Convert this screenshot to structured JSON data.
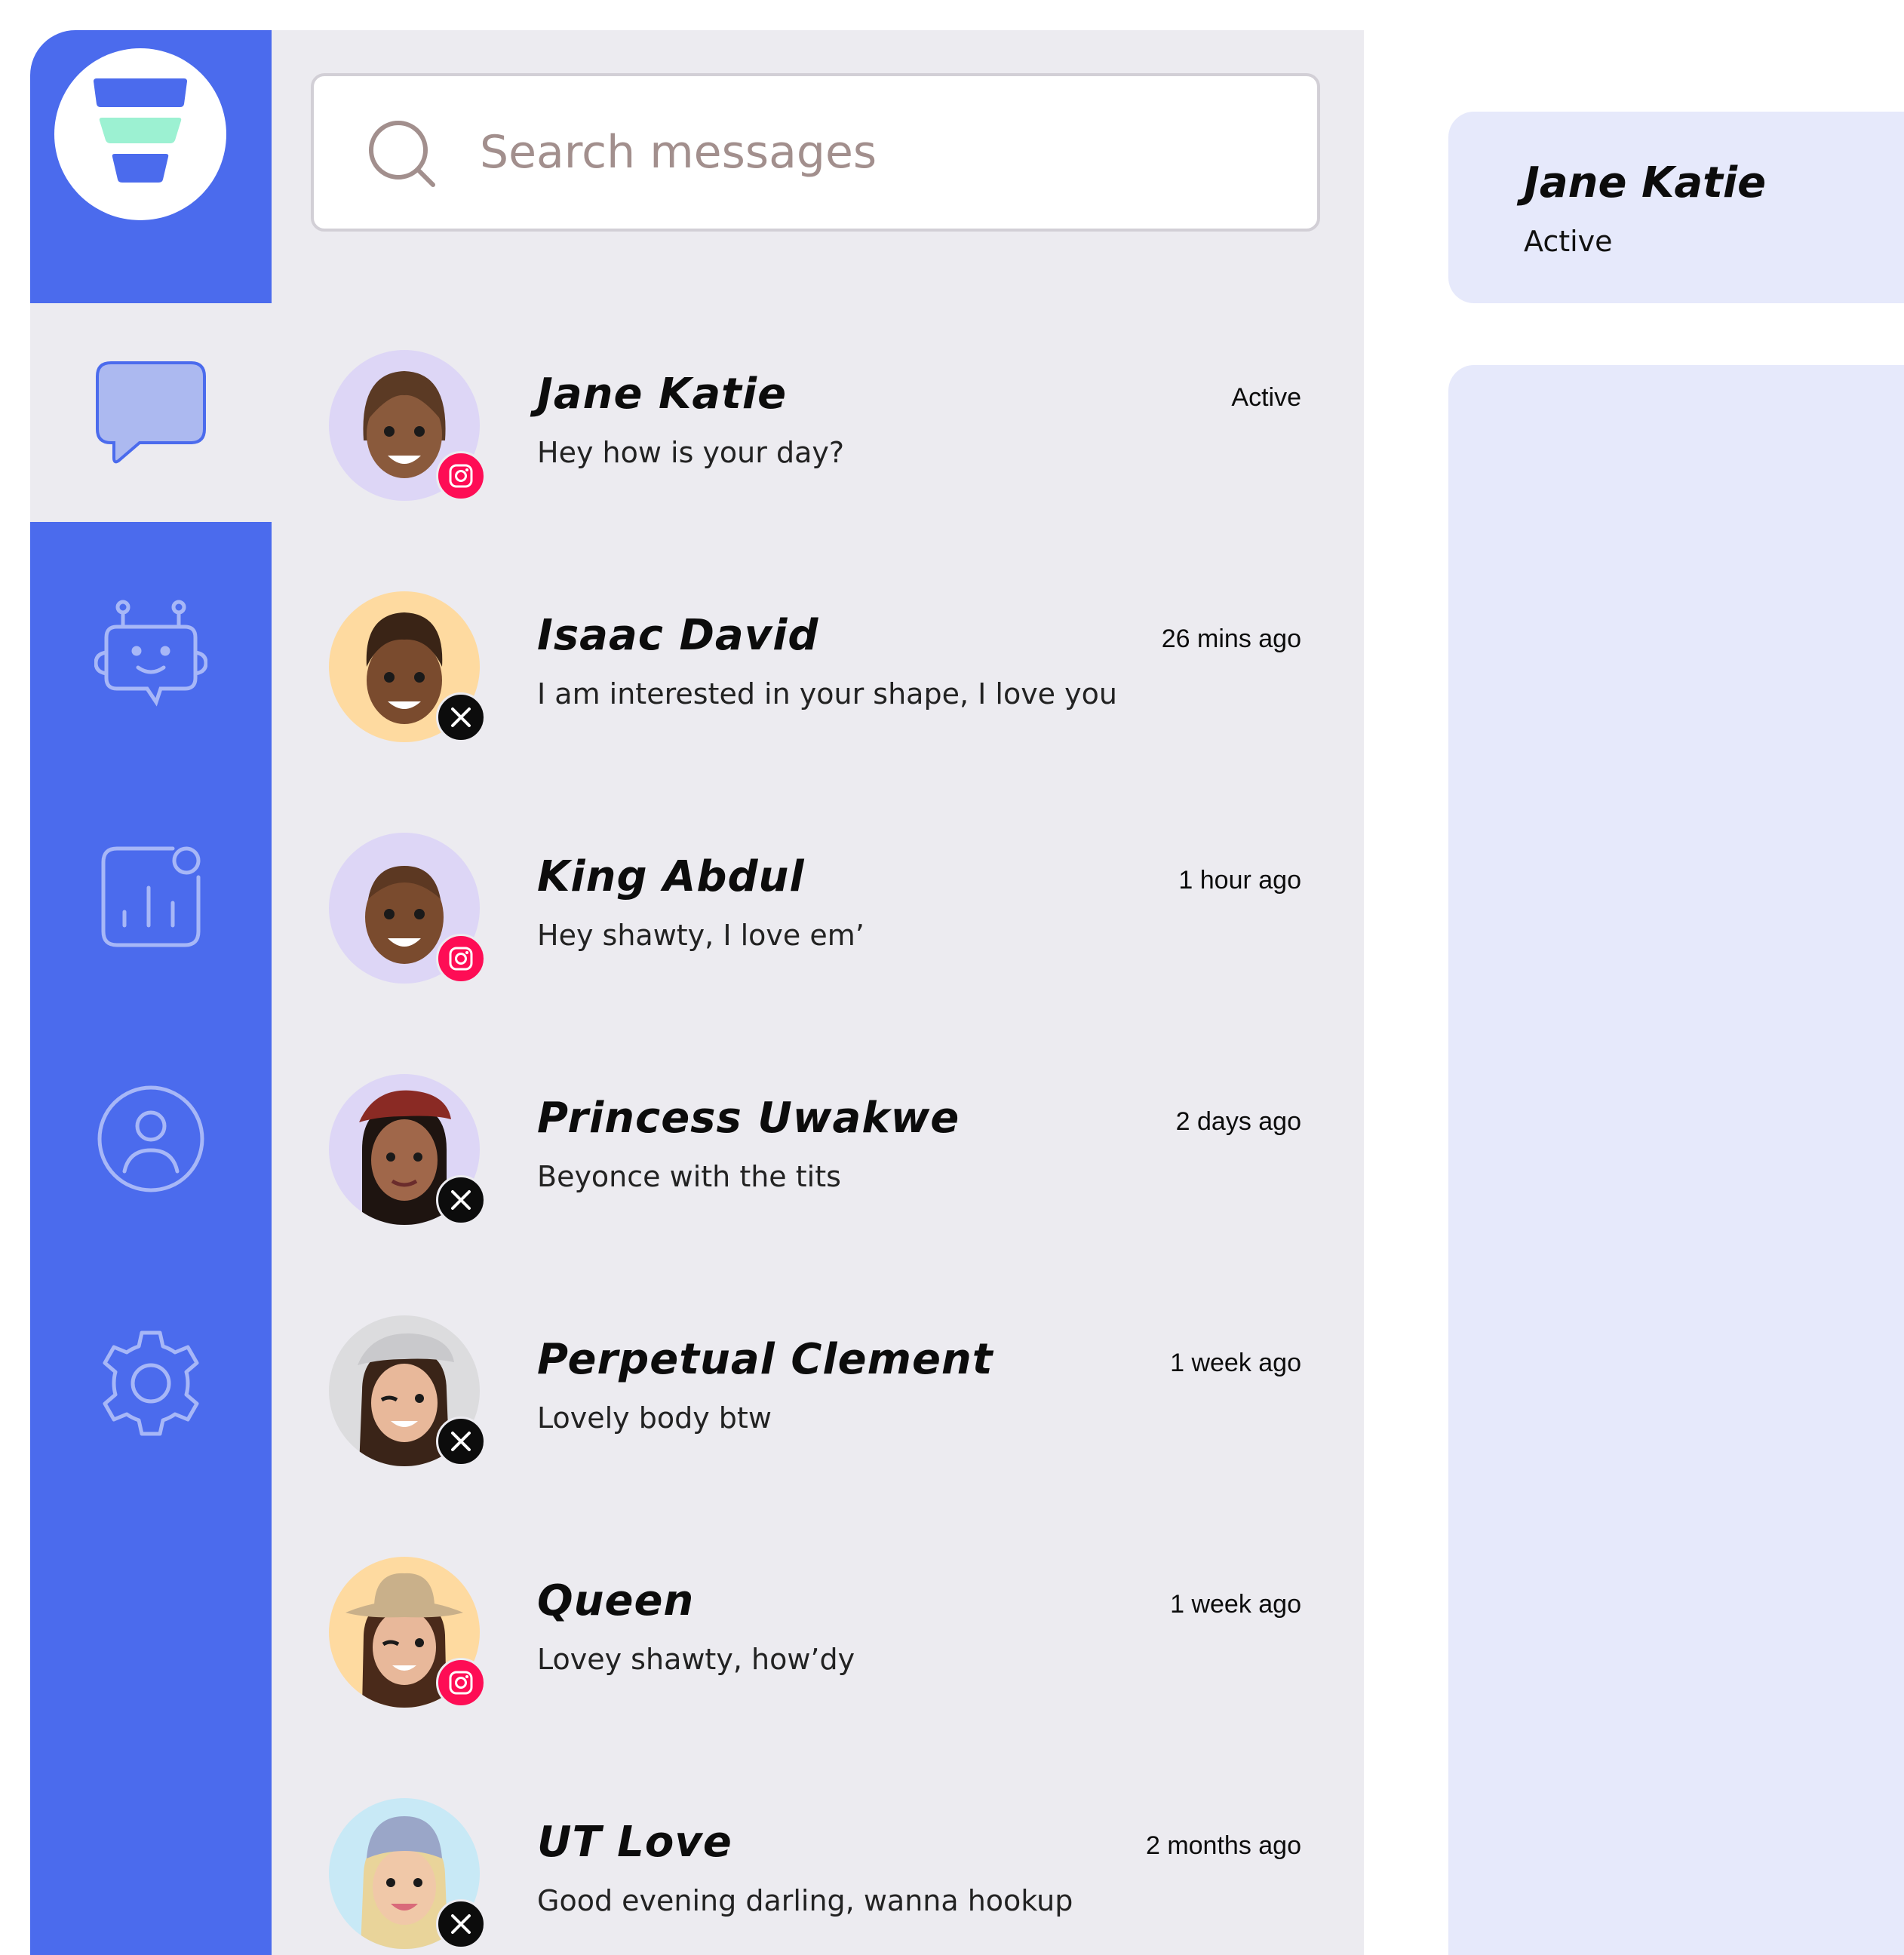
{
  "search": {
    "placeholder": "Search messages"
  },
  "nav": {
    "items": [
      {
        "icon": "chat-bubble-icon",
        "active": true
      },
      {
        "icon": "robot-icon",
        "active": false
      },
      {
        "icon": "analytics-icon",
        "active": false
      },
      {
        "icon": "user-profile-icon",
        "active": false
      },
      {
        "icon": "gear-icon",
        "active": false
      }
    ]
  },
  "conversations": [
    {
      "name": "Jane Katie",
      "time": "Active",
      "preview": "Hey how is your day?",
      "platform": "instagram",
      "avatar_bg": "#ddd6f6"
    },
    {
      "name": "Isaac David",
      "time": "26 mins ago",
      "preview": "I am interested in your shape, I love you",
      "platform": "x",
      "avatar_bg": "#fedaa0"
    },
    {
      "name": "King Abdul",
      "time": "1 hour ago",
      "preview": "Hey shawty, I love em’",
      "platform": "instagram",
      "avatar_bg": "#ddd6f6"
    },
    {
      "name": "Princess Uwakwe",
      "time": "2 days ago",
      "preview": "Beyonce with the tits",
      "platform": "x",
      "avatar_bg": "#ddd6f6"
    },
    {
      "name": "Perpetual Clement",
      "time": "1 week ago",
      "preview": "Lovely body btw",
      "platform": "x",
      "avatar_bg": "#dcdcde"
    },
    {
      "name": "Queen",
      "time": "1 week ago",
      "preview": "Lovey shawty, how’dy",
      "platform": "instagram",
      "avatar_bg": "#fedaa0"
    },
    {
      "name": "UT Love",
      "time": "2 months ago",
      "preview": "Good evening darling, wanna hookup",
      "platform": "x",
      "avatar_bg": "#c8e9f6"
    }
  ],
  "chat": {
    "name": "Jane Katie",
    "status": "Active"
  },
  "colors": {
    "rail": "#4b6bed",
    "list_background": "#ecebf0",
    "chat_pane": "#e6e9fb",
    "instagram_badge": "#fe0d55",
    "x_badge": "#0c0c0c",
    "logo_accent": "#9cf1d2"
  }
}
